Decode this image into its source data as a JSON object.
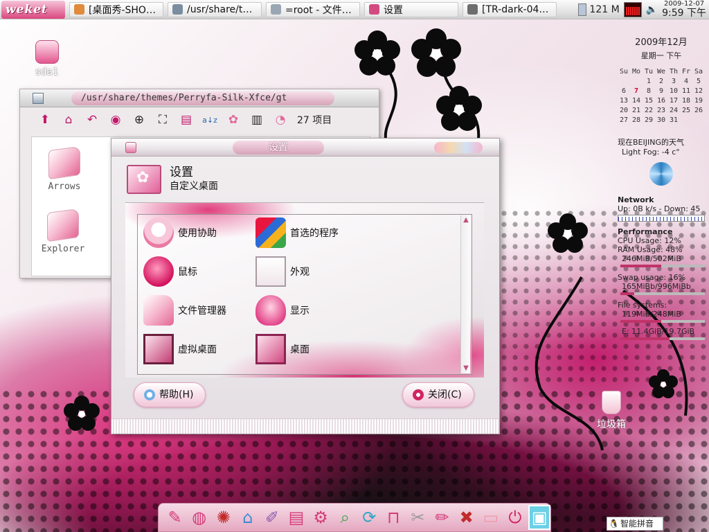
{
  "top_panel": {
    "logo": "weket",
    "tasks": [
      {
        "label": "[桌面秀-SHO…",
        "color": "#e08a3c"
      },
      {
        "label": "/usr/share/t…",
        "color": "#7a8ea0"
      },
      {
        "label": "=root - 文件…",
        "color": "#9aa6b4"
      },
      {
        "label": "设置",
        "color": "#d34a80"
      },
      {
        "label": "[TR-dark-04…",
        "color": "#6d6d6d"
      }
    ],
    "memory": "121 M",
    "clock_date": "2009-12-07",
    "clock_time": "9:59 下午"
  },
  "desktop": {
    "drive_label": "sda1",
    "trash_label": "垃圾箱"
  },
  "file_manager": {
    "title": "/usr/share/themes/Perryfa-Silk-Xfce/gt",
    "item_count": "27 项目",
    "items": [
      "Arrows",
      "Explorer"
    ]
  },
  "settings": {
    "title": "设置",
    "heading": "设置",
    "subheading": "自定义桌面",
    "categories": [
      {
        "label": "使用协助",
        "icon": "accessibility-icon"
      },
      {
        "label": "首选的程序",
        "icon": "preferred-apps-icon"
      },
      {
        "label": "鼠标",
        "icon": "mouse-icon"
      },
      {
        "label": "外观",
        "icon": "appearance-icon"
      },
      {
        "label": "文件管理器",
        "icon": "file-manager-icon"
      },
      {
        "label": "显示",
        "icon": "display-icon"
      },
      {
        "label": "虚拟桌面",
        "icon": "virtual-desktop-icon"
      },
      {
        "label": "桌面",
        "icon": "desktop-icon"
      }
    ],
    "help_button": "帮助(H)",
    "close_button": "关闭(C)"
  },
  "widgets": {
    "month": "2009年12月",
    "weekday_time": "星期一 下午",
    "calendar_header": [
      "Su",
      "Mo",
      "Tu",
      "We",
      "Th",
      "Fr",
      "Sa"
    ],
    "calendar_days": [
      "",
      "",
      "1",
      "2",
      "3",
      "4",
      "5",
      "6",
      "7",
      "8",
      "9",
      "10",
      "11",
      "12",
      "13",
      "14",
      "15",
      "16",
      "17",
      "18",
      "19",
      "20",
      "21",
      "22",
      "23",
      "24",
      "25",
      "26",
      "27",
      "28",
      "29",
      "30",
      "31"
    ],
    "today": "7",
    "weather_title": "现在BEIJING的天气",
    "weather": "Light Fog: -4 c°",
    "network_title": "Network",
    "network_line": "Up: 0B  k/s - Down: 45",
    "performance_title": "Performance",
    "cpu": "CPU Usage: 12%",
    "ram": "RAM Usage: 48%",
    "ram_detail": "246MiB/502MiB",
    "ram_fraction": 0.48,
    "swap": "Swap usage: 16%",
    "swap_detail": "165MiBb/996MiBb",
    "swap_fraction": 0.16,
    "fs_title": "File systems:",
    "fs_root": "119MiB/248MiB",
    "fs_root_fraction": 0.48,
    "fs_e": "E: 11.4GiB/19.7GiB",
    "fs_e_fraction": 0.58
  },
  "ime": {
    "label": "智能拼音"
  }
}
